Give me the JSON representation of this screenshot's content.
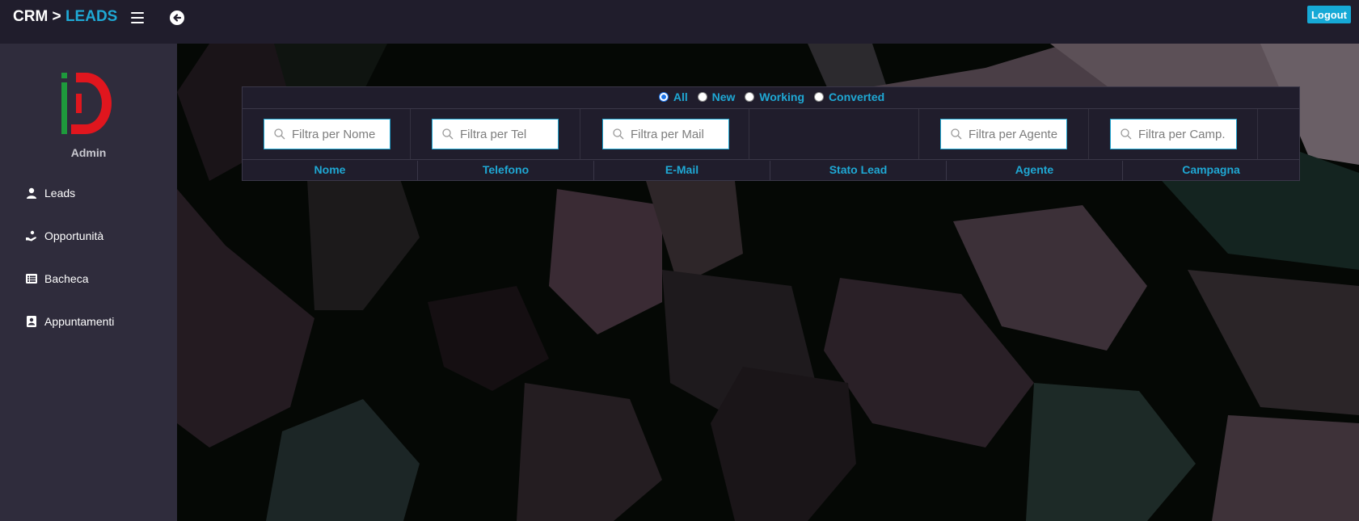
{
  "header": {
    "brand_prefix": "CRM > ",
    "brand_section": "LEADS",
    "menu_icon": "hamburger-icon",
    "back_icon": "arrow-left-circle-icon",
    "logout_label": "Logout"
  },
  "sidebar": {
    "user_label": "Admin",
    "items": [
      {
        "label": "Leads",
        "icon": "user-icon"
      },
      {
        "label": "Opportunità",
        "icon": "hand-holding-icon"
      },
      {
        "label": "Bacheca",
        "icon": "list-icon"
      },
      {
        "label": "Appuntamenti",
        "icon": "contact-card-icon"
      }
    ]
  },
  "filters": {
    "status_options": [
      "All",
      "New",
      "Working",
      "Converted"
    ],
    "selected_status": "All",
    "nome_placeholder": "Filtra per Nome",
    "tel_placeholder": "Filtra per Tel",
    "mail_placeholder": "Filtra per Mail",
    "agente_placeholder": "Filtra per Agente",
    "campagna_placeholder": "Filtra per Camp."
  },
  "table": {
    "columns": [
      "Nome",
      "Telefono",
      "E-Mail",
      "Stato Lead",
      "Agente",
      "Campagna"
    ]
  },
  "colors": {
    "accent": "#1fa8d4",
    "logo_green": "#1e9a3c",
    "logo_red": "#e0161e"
  }
}
